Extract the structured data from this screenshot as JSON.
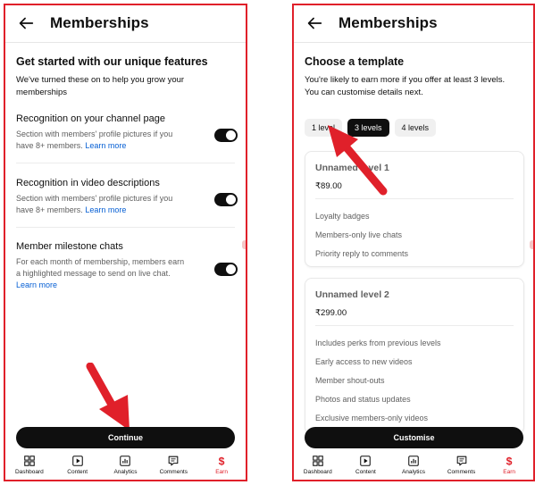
{
  "left": {
    "title": "Memberships",
    "heading": "Get started with our unique features",
    "subheading_line1": "We've turned these on to help you grow your",
    "subheading_line2": "memberships",
    "features": [
      {
        "title": "Recognition on your channel page",
        "desc_line1": "Section with members' profile pictures if you",
        "desc_line2": "have 8+ members.",
        "link": "Learn more",
        "enabled": true
      },
      {
        "title": "Recognition in video descriptions",
        "desc_line1": "Section with members' profile pictures if you",
        "desc_line2": "have 8+ members.",
        "link": "Learn more",
        "enabled": true
      },
      {
        "title": "Member milestone chats",
        "desc_line1": "For each month of membership, members earn",
        "desc_line2": "a highlighted message to send on live chat.",
        "link": "Learn more",
        "enabled": true
      }
    ],
    "button_label": "Continue"
  },
  "right": {
    "title": "Memberships",
    "heading": "Choose a template",
    "subheading_line1": "You're likely to earn more if you offer at least 3 levels.",
    "subheading_line2": "You can customise details next.",
    "chips": [
      "1 level",
      "3 levels",
      "4 levels"
    ],
    "selected_chip": "3 levels",
    "levels": [
      {
        "title": "Unnamed level 1",
        "price": "₹89.00",
        "perks": [
          "Loyalty badges",
          "Members-only live chats",
          "Priority reply to comments"
        ]
      },
      {
        "title": "Unnamed level 2",
        "price": "₹299.00",
        "perks": [
          "Includes perks from previous levels",
          "Early access to new videos",
          "Member shout-outs",
          "Photos and status updates",
          "Exclusive members-only videos"
        ]
      }
    ],
    "button_label": "Customise"
  },
  "nav": {
    "items": [
      {
        "label": "Dashboard",
        "icon": "dashboard-icon"
      },
      {
        "label": "Content",
        "icon": "content-icon"
      },
      {
        "label": "Analytics",
        "icon": "analytics-icon"
      },
      {
        "label": "Comments",
        "icon": "comments-icon"
      },
      {
        "label": "Earn",
        "icon": "earn-icon",
        "active": true
      }
    ]
  },
  "colors": {
    "accent": "#e0202a",
    "link": "#065fd4",
    "dark": "#0f0f0f"
  }
}
